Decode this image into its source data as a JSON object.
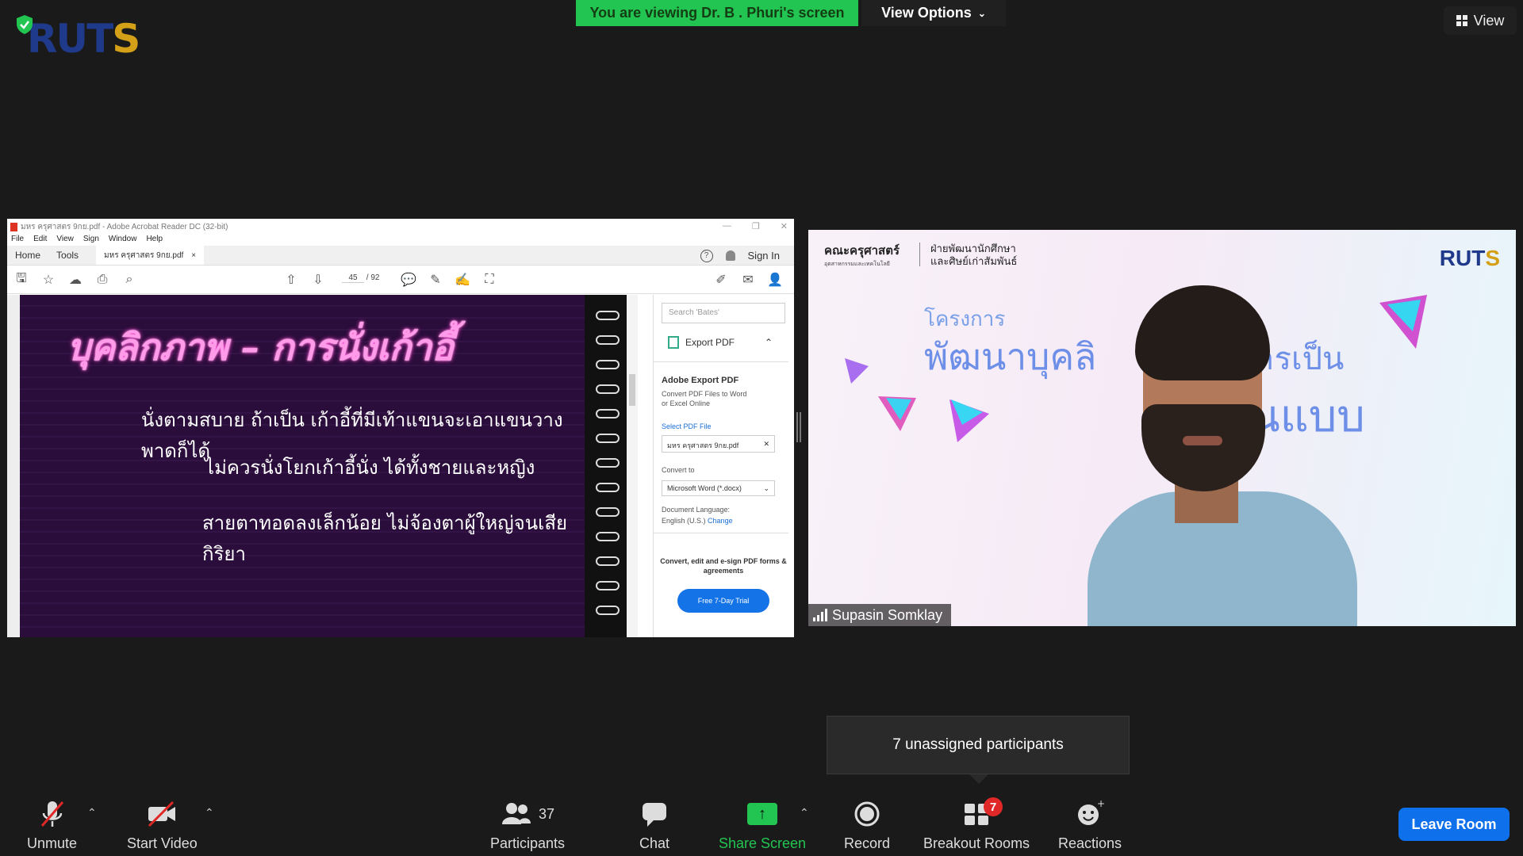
{
  "banner": {
    "viewing_text": "You are viewing Dr. B . Phuri's screen",
    "view_options": "View Options",
    "view_button": "View"
  },
  "logo": {
    "text_main": "RUT",
    "text_accent": "S"
  },
  "acrobat": {
    "title": "มหร ครุศาสตร 9กย.pdf - Adobe Acrobat Reader DC (32-bit)",
    "menu": [
      "File",
      "Edit",
      "View",
      "Sign",
      "Window",
      "Help"
    ],
    "tabs": {
      "home": "Home",
      "tools": "Tools",
      "doc": "มหร ครุศาสตร 9กย.pdf",
      "sign_in": "Sign In"
    },
    "page_current": "45",
    "page_total": "/ 92",
    "slide": {
      "title": "บุคลิกภาพ – การนั่งเก้าอี้",
      "line1": "นั่งตามสบาย   ถ้าเป็น เก้าอี้ที่มีเท้าแขนจะเอาแขนวางพาดก็ได้",
      "line2": "ไม่ควรนั่งโยกเก้าอี้นั่ง ได้ทั้งชายและหญิง",
      "line3": "สายตาทอดลงเล็กน้อย    ไม่จ้องตาผู้ใหญ่จนเสียกิริยา"
    },
    "panel": {
      "search_placeholder": "Search 'Bates'",
      "export_pdf": "Export PDF",
      "heading": "Adobe Export PDF",
      "desc": "Convert PDF Files to Word or Excel Online",
      "select_file": "Select PDF File",
      "file_name": "มหร ครุศาสตร 9กย.pdf",
      "convert_to": "Convert to",
      "format": "Microsoft Word (*.docx)",
      "doc_lang": "Document Language:",
      "lang_value": "English (U.S.)",
      "change": "Change",
      "promo": "Convert, edit and e-sign PDF forms & agreements",
      "trial": "Free 7-Day Trial"
    }
  },
  "video": {
    "faculty": "คณะครุศาสตร์",
    "faculty_sub": "อุตสาหกรรมและเทคโนโลยี",
    "division_line1": "ฝ่ายพัฒนานักศึกษา",
    "division_line2": "และศิษย์เก่าสัมพันธ์",
    "project_small": "โครงการ",
    "project_big": "พัฒนาบุคลิ",
    "project_big2": "ารเป็น",
    "project_big3": "ต้นแบบ",
    "logo_main": "RUT",
    "logo_accent": "S",
    "participant_name": "Supasin Somklay"
  },
  "tooltip": "7 unassigned participants",
  "toolbar": {
    "unmute": "Unmute",
    "start_video": "Start Video",
    "participants": "Participants",
    "participants_count": "37",
    "chat": "Chat",
    "share_screen": "Share Screen",
    "record": "Record",
    "breakout_rooms": "Breakout Rooms",
    "breakout_badge": "7",
    "reactions": "Reactions",
    "leave_room": "Leave Room"
  },
  "colors": {
    "share_green": "#23c552",
    "leave_blue": "#0e71eb",
    "badge_red": "#e02828"
  }
}
